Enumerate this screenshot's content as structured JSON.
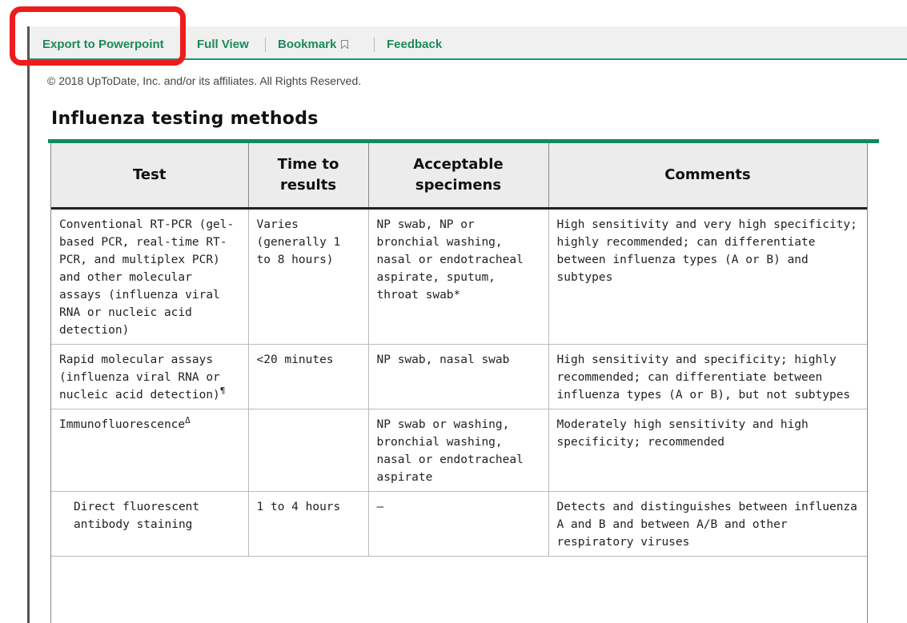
{
  "toolbar": {
    "export_label": "Export to Powerpoint",
    "full_view_label": "Full View",
    "bookmark_label": "Bookmark",
    "feedback_label": "Feedback",
    "accent_color": "#1a8a5a"
  },
  "annotation": {
    "highlight_color": "#ee1c1c"
  },
  "copyright": "© 2018 UpToDate, Inc. and/or its affiliates. All Rights Reserved.",
  "title": "Influenza testing methods",
  "table": {
    "headers": [
      "Test",
      "Time to results",
      "Acceptable specimens",
      "Comments"
    ],
    "rows": [
      {
        "test": "Conventional RT-PCR (gel-based PCR, real-time RT-PCR, and multiplex PCR) and other molecular assays (influenza viral RNA or nucleic acid detection)",
        "test_mark": "",
        "time": "Varies (generally 1 to 8 hours)",
        "specimens": "NP swab, NP or bronchial washing, nasal or endotracheal aspirate, sputum, throat swab*",
        "comments": "High sensitivity and very high specificity; highly recommended; can differentiate between influenza types (A or B) and subtypes"
      },
      {
        "test": "Rapid molecular assays (influenza viral RNA or nucleic acid detection)",
        "test_mark": "¶",
        "time": "<20 minutes",
        "specimens": "NP swab, nasal swab",
        "comments": "High sensitivity and specificity; highly recommended; can differentiate between influenza types (A or B), but not subtypes"
      },
      {
        "test": "Immunofluorescence",
        "test_mark": "Δ",
        "time": "",
        "specimens": "NP swab or washing, bronchial washing, nasal or endotracheal aspirate",
        "comments": "Moderately high sensitivity and high specificity; recommended"
      },
      {
        "test": "Direct fluorescent antibody staining",
        "test_mark": "",
        "time": "1 to 4 hours",
        "specimens": "–",
        "comments": "Detects and distinguishes between influenza A and B and between A/B and other respiratory viruses"
      }
    ]
  }
}
